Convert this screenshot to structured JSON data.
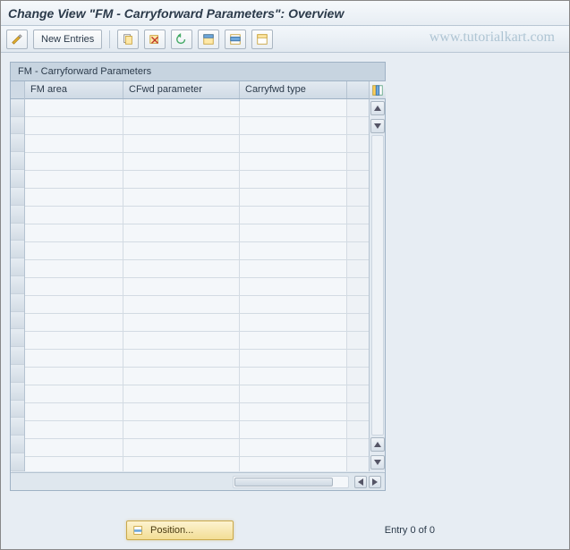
{
  "title": "Change View \"FM - Carryforward Parameters\": Overview",
  "watermark": "www.tutorialkart.com",
  "toolbar": {
    "new_entries_label": "New Entries"
  },
  "panel": {
    "header": "FM - Carryforward Parameters",
    "columns": [
      "FM area",
      "CFwd parameter",
      "Carryfwd type"
    ],
    "rows": [
      [
        "",
        "",
        ""
      ],
      [
        "",
        "",
        ""
      ],
      [
        "",
        "",
        ""
      ],
      [
        "",
        "",
        ""
      ],
      [
        "",
        "",
        ""
      ],
      [
        "",
        "",
        ""
      ],
      [
        "",
        "",
        ""
      ],
      [
        "",
        "",
        ""
      ],
      [
        "",
        "",
        ""
      ],
      [
        "",
        "",
        ""
      ],
      [
        "",
        "",
        ""
      ],
      [
        "",
        "",
        ""
      ],
      [
        "",
        "",
        ""
      ],
      [
        "",
        "",
        ""
      ],
      [
        "",
        "",
        ""
      ],
      [
        "",
        "",
        ""
      ],
      [
        "",
        "",
        ""
      ],
      [
        "",
        "",
        ""
      ],
      [
        "",
        "",
        ""
      ],
      [
        "",
        "",
        ""
      ],
      [
        "",
        "",
        ""
      ]
    ]
  },
  "footer": {
    "position_label": "Position...",
    "entry_status": "Entry 0 of 0"
  },
  "colors": {
    "panel_bg": "#dfe7ee",
    "accent_yellow": "#f2dd95"
  }
}
